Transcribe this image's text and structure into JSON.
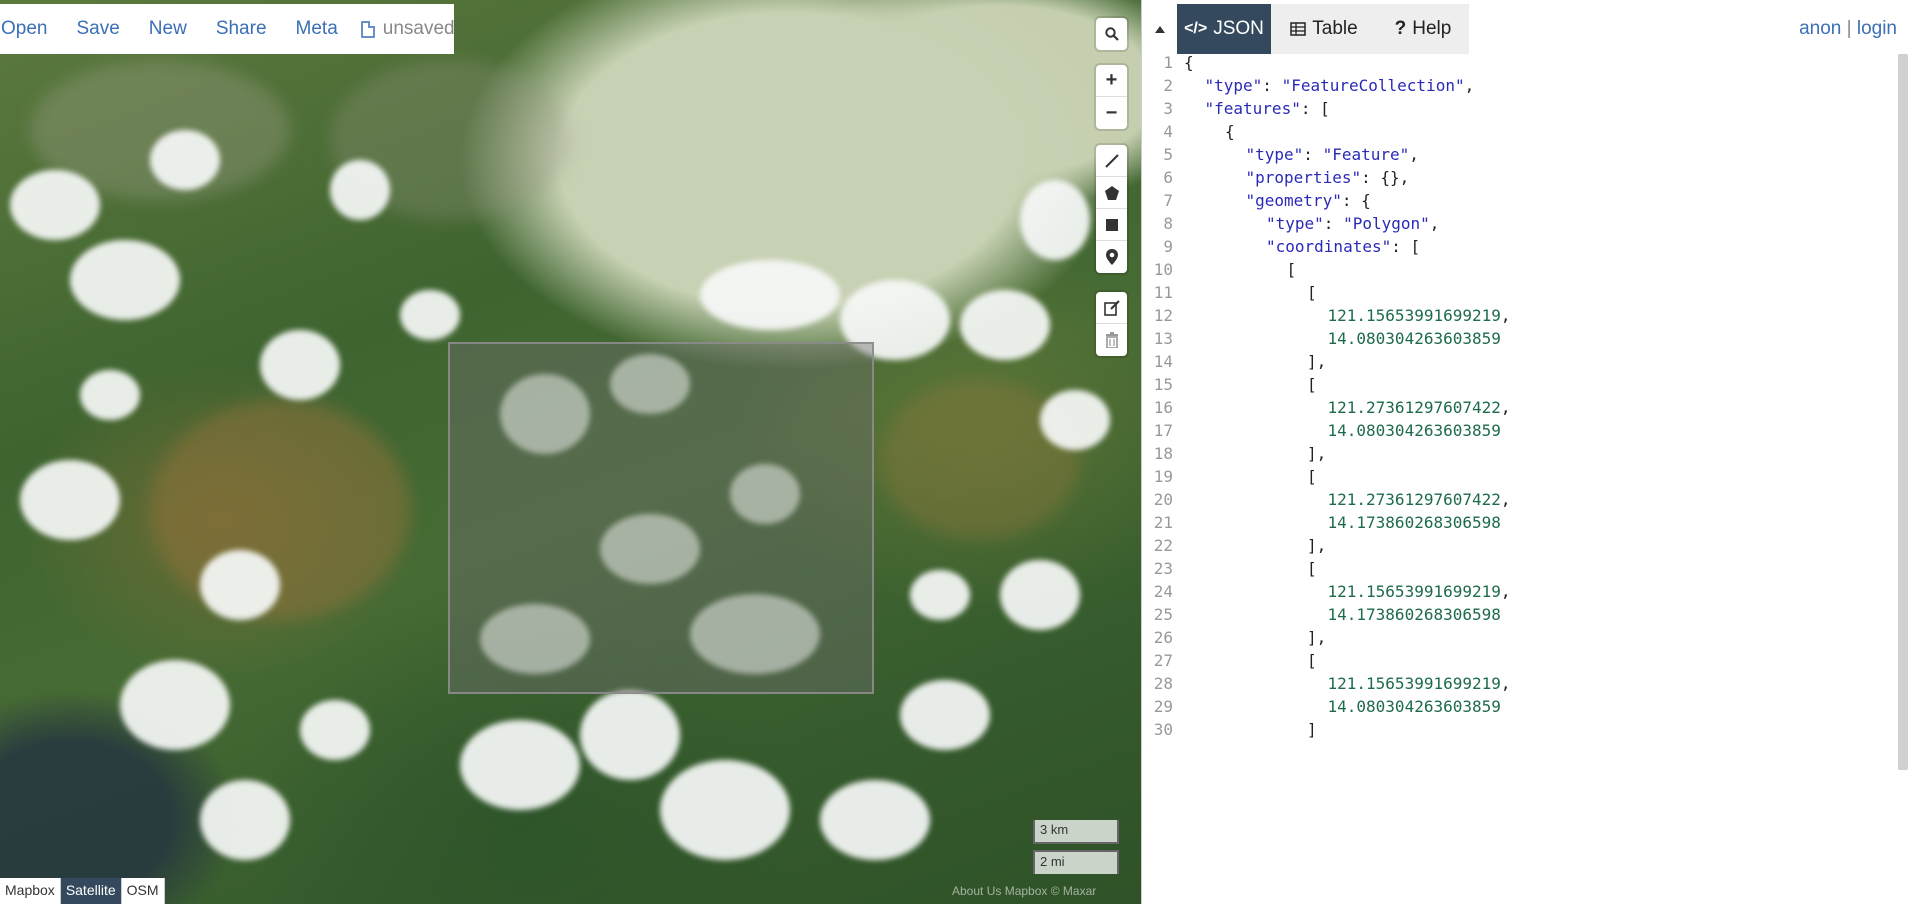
{
  "menu": {
    "items": [
      "Open",
      "Save",
      "New",
      "Share",
      "Meta"
    ],
    "file_status": "unsaved"
  },
  "map_controls": {
    "zoom_in": "+",
    "zoom_out": "−"
  },
  "scale": {
    "km": "3 km",
    "mi": "2 mi"
  },
  "layers": {
    "items": [
      "Mapbox",
      "Satellite",
      "OSM"
    ],
    "active": "Satellite"
  },
  "attribution": "About Us Mapbox © Maxar",
  "pane": {
    "tabs": [
      {
        "label": "JSON",
        "icon": "code-icon",
        "active": true
      },
      {
        "label": "Table",
        "icon": "table-icon",
        "active": false
      },
      {
        "label": "Help",
        "icon": "question-icon",
        "active": false
      }
    ],
    "auth": {
      "anon": "anon",
      "separator": "|",
      "login": "login"
    }
  },
  "editor": {
    "lines": [
      {
        "n": "1",
        "indent": 0,
        "parts": [
          [
            "p",
            "{"
          ]
        ]
      },
      {
        "n": "2",
        "indent": 1,
        "parts": [
          [
            "k",
            "\"type\""
          ],
          [
            "p",
            ": "
          ],
          [
            "s",
            "\"FeatureCollection\""
          ],
          [
            "p",
            ","
          ]
        ]
      },
      {
        "n": "3",
        "indent": 1,
        "parts": [
          [
            "k",
            "\"features\""
          ],
          [
            "p",
            ": ["
          ]
        ]
      },
      {
        "n": "4",
        "indent": 2,
        "parts": [
          [
            "p",
            "{"
          ]
        ]
      },
      {
        "n": "5",
        "indent": 3,
        "parts": [
          [
            "k",
            "\"type\""
          ],
          [
            "p",
            ": "
          ],
          [
            "s",
            "\"Feature\""
          ],
          [
            "p",
            ","
          ]
        ]
      },
      {
        "n": "6",
        "indent": 3,
        "parts": [
          [
            "k",
            "\"properties\""
          ],
          [
            "p",
            ": {},"
          ]
        ]
      },
      {
        "n": "7",
        "indent": 3,
        "parts": [
          [
            "k",
            "\"geometry\""
          ],
          [
            "p",
            ": {"
          ]
        ]
      },
      {
        "n": "8",
        "indent": 4,
        "parts": [
          [
            "k",
            "\"type\""
          ],
          [
            "p",
            ": "
          ],
          [
            "s",
            "\"Polygon\""
          ],
          [
            "p",
            ","
          ]
        ]
      },
      {
        "n": "9",
        "indent": 4,
        "parts": [
          [
            "k",
            "\"coordinates\""
          ],
          [
            "p",
            ": ["
          ]
        ]
      },
      {
        "n": "10",
        "indent": 5,
        "parts": [
          [
            "p",
            "["
          ]
        ]
      },
      {
        "n": "11",
        "indent": 6,
        "parts": [
          [
            "p",
            "["
          ]
        ]
      },
      {
        "n": "12",
        "indent": 7,
        "parts": [
          [
            "n",
            "121.15653991699219"
          ],
          [
            "p",
            ","
          ]
        ]
      },
      {
        "n": "13",
        "indent": 7,
        "parts": [
          [
            "n",
            "14.080304263603859"
          ]
        ]
      },
      {
        "n": "14",
        "indent": 6,
        "parts": [
          [
            "p",
            "],"
          ]
        ]
      },
      {
        "n": "15",
        "indent": 6,
        "parts": [
          [
            "p",
            "["
          ]
        ]
      },
      {
        "n": "16",
        "indent": 7,
        "parts": [
          [
            "n",
            "121.27361297607422"
          ],
          [
            "p",
            ","
          ]
        ]
      },
      {
        "n": "17",
        "indent": 7,
        "parts": [
          [
            "n",
            "14.080304263603859"
          ]
        ]
      },
      {
        "n": "18",
        "indent": 6,
        "parts": [
          [
            "p",
            "],"
          ]
        ]
      },
      {
        "n": "19",
        "indent": 6,
        "parts": [
          [
            "p",
            "["
          ]
        ]
      },
      {
        "n": "20",
        "indent": 7,
        "parts": [
          [
            "n",
            "121.27361297607422"
          ],
          [
            "p",
            ","
          ]
        ]
      },
      {
        "n": "21",
        "indent": 7,
        "parts": [
          [
            "n",
            "14.173860268306598"
          ]
        ]
      },
      {
        "n": "22",
        "indent": 6,
        "parts": [
          [
            "p",
            "],"
          ]
        ]
      },
      {
        "n": "23",
        "indent": 6,
        "parts": [
          [
            "p",
            "["
          ]
        ]
      },
      {
        "n": "24",
        "indent": 7,
        "parts": [
          [
            "n",
            "121.15653991699219"
          ],
          [
            "p",
            ","
          ]
        ]
      },
      {
        "n": "25",
        "indent": 7,
        "parts": [
          [
            "n",
            "14.173860268306598"
          ]
        ]
      },
      {
        "n": "26",
        "indent": 6,
        "parts": [
          [
            "p",
            "],"
          ]
        ]
      },
      {
        "n": "27",
        "indent": 6,
        "parts": [
          [
            "p",
            "["
          ]
        ]
      },
      {
        "n": "28",
        "indent": 7,
        "parts": [
          [
            "n",
            "121.15653991699219"
          ],
          [
            "p",
            ","
          ]
        ]
      },
      {
        "n": "29",
        "indent": 7,
        "parts": [
          [
            "n",
            "14.080304263603859"
          ]
        ]
      },
      {
        "n": "30",
        "indent": 6,
        "parts": [
          [
            "p",
            "]"
          ]
        ]
      }
    ]
  }
}
